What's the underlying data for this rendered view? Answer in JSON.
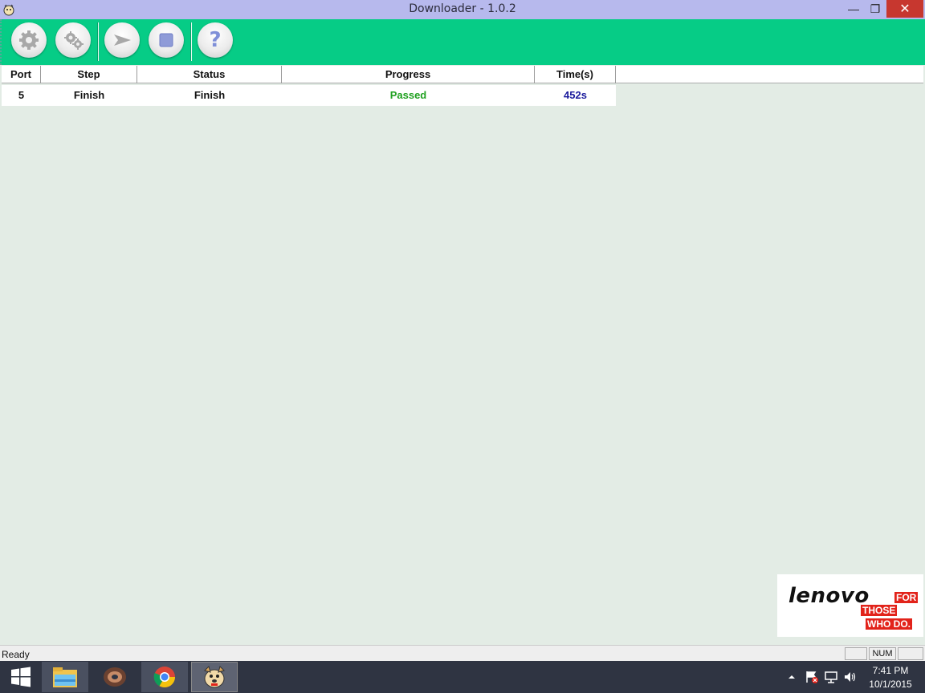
{
  "window": {
    "title": "Downloader - 1.0.2",
    "min_glyph": "—",
    "max_glyph": "❐",
    "close_glyph": "✕"
  },
  "toolbar": {
    "buttons": [
      {
        "name": "settings-button",
        "icon": "gear-icon"
      },
      {
        "name": "advanced-settings-button",
        "icon": "gears-icon"
      },
      {
        "name": "start-button",
        "icon": "play-arrow-icon"
      },
      {
        "name": "stop-button",
        "icon": "stop-square-icon"
      },
      {
        "name": "help-button",
        "icon": "question-mark-icon"
      }
    ],
    "help_glyph": "?"
  },
  "table": {
    "headers": [
      "Port",
      "Step",
      "Status",
      "Progress",
      "Time(s)"
    ],
    "rows": [
      {
        "port": "5",
        "step": "Finish",
        "status": "Finish",
        "progress": "Passed",
        "time": "452s"
      }
    ]
  },
  "colors": {
    "toolbar_bg": "#06cc86",
    "progress_text": "#1fa01f",
    "time_text": "#1a1a9c",
    "title_bg": "#b7b9ed"
  },
  "logo": {
    "brand": "lenovo",
    "tag_line1": "FOR",
    "tag_line2": "THOSE",
    "tag_line3": "WHO DO."
  },
  "status_bar": {
    "text": "Ready",
    "num": "NUM"
  },
  "taskbar": {
    "time": "7:41 PM",
    "date": "10/1/2015",
    "apps": [
      "file-explorer-icon",
      "donut-app-icon",
      "chrome-icon",
      "downloader-dog-icon"
    ]
  }
}
